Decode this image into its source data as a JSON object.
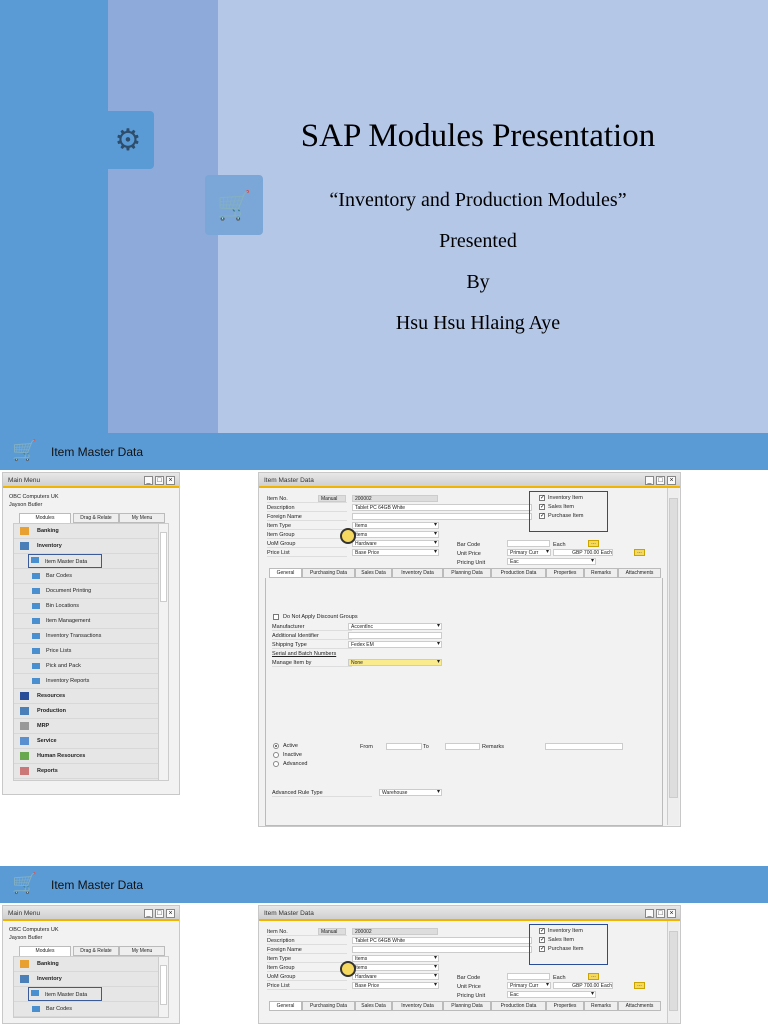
{
  "slide1": {
    "title": "SAP Modules Presentation",
    "subtitle": "“Inventory and Production Modules”",
    "presented": "Presented",
    "by": "By",
    "author": "Hsu Hsu Hlaing Aye",
    "icons": [
      "factory-gear-icon",
      "cart-icon"
    ]
  },
  "slide2": {
    "header": "Item Master Data"
  },
  "main_menu": {
    "title": "Main Menu",
    "company": "OBC Computers UK",
    "user": "Jayson Butler",
    "tabs": [
      "Modules",
      "Drag & Relate",
      "My Menu"
    ],
    "modules_top": [
      "Banking",
      "Inventory"
    ],
    "inventory_items": [
      "Item Master Data",
      "Bar Codes",
      "Document Printing",
      "Bin Locations",
      "Item Management",
      "Inventory Transactions",
      "Price Lists",
      "Pick and Pack",
      "Inventory Reports"
    ],
    "modules_bottom": [
      "Resources",
      "Production",
      "MRP",
      "Service",
      "Human Resources",
      "Reports"
    ]
  },
  "item_master": {
    "title": "Item Master Data",
    "labels": {
      "item_no": "Item No.",
      "description": "Description",
      "foreign_name": "Foreign Name",
      "item_type": "Item Type",
      "item_group": "Item Group",
      "uom_group": "UoM Group",
      "price_list": "Price List",
      "bar_code": "Bar Code",
      "unit_price": "Unit Price",
      "pricing_unit": "Pricing Unit"
    },
    "values": {
      "series": "Manual",
      "item_no": "200002",
      "description": "Tablet PC 64GB White",
      "item_type": "Items",
      "item_group": "Items",
      "uom_group": "Hardware",
      "price_list": "Base Price",
      "bar_code_unit": "Each",
      "price_currency": "Primary Curr",
      "price": "GBP 700.00 Each",
      "pricing_unit": "Eac"
    },
    "checkboxes": [
      "Inventory Item",
      "Sales Item",
      "Purchase Item"
    ],
    "tabs": [
      "General",
      "Purchasing Data",
      "Sales Data",
      "Inventory Data",
      "Planning Data",
      "Production Data",
      "Properties",
      "Remarks",
      "Attachments"
    ],
    "general": {
      "discount": "Do Not Apply Discount Groups",
      "manufacturer_label": "Manufacturer",
      "manufacturer": "AccentInc",
      "addl_label": "Additional Identifier",
      "shipping_label": "Shipping Type",
      "shipping": "Fedex EM",
      "serial_link": "Serial and Batch Numbers",
      "manage_label": "Manage Item by",
      "manage": "None",
      "status": [
        "Active",
        "Inactive",
        "Advanced"
      ],
      "from": "From",
      "to": "To",
      "remarks": "Remarks",
      "rule_label": "Advanced Rule Type",
      "rule": "Warehouse"
    }
  },
  "colors": {
    "blue": "#5b9bd5",
    "mid": "#8eaadb",
    "light": "#b4c7e7"
  }
}
